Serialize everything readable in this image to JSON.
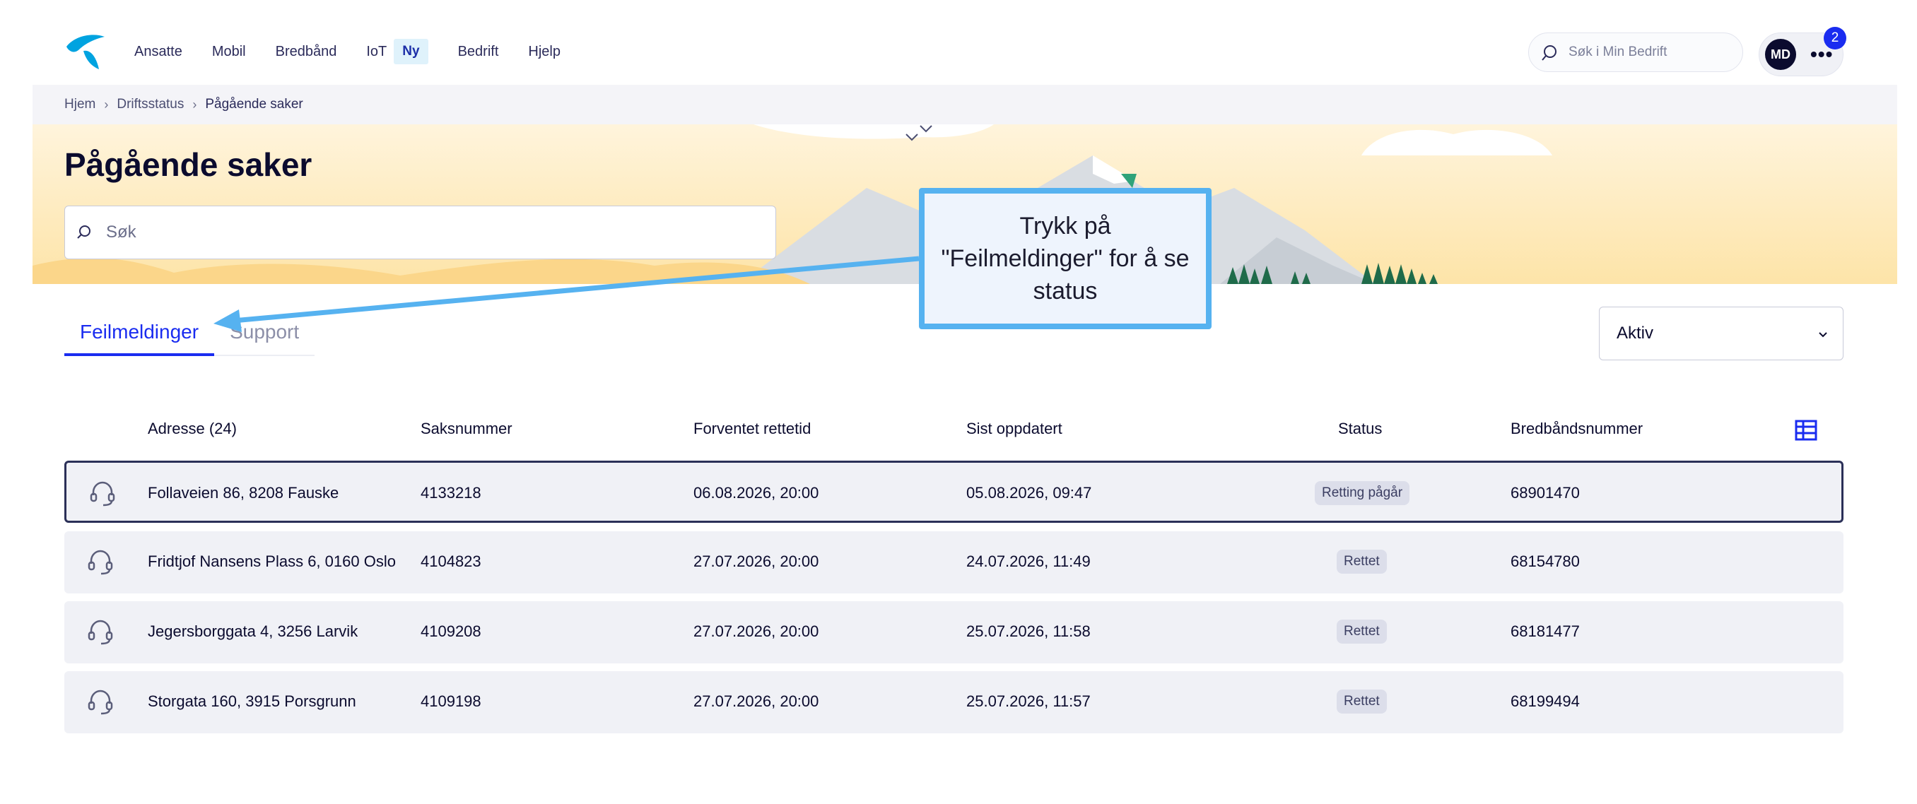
{
  "nav": {
    "items": [
      "Ansatte",
      "Mobil",
      "Bredbånd",
      "IoT",
      "Bedrift",
      "Hjelp"
    ],
    "iot_badge": "Ny",
    "search_placeholder": "Søk i Min Bedrift",
    "user_initials": "MD",
    "notification_count": "2"
  },
  "breadcrumb": [
    "Hjem",
    "Driftsstatus",
    "Pågående saker"
  ],
  "page": {
    "title": "Pågående saker",
    "search_placeholder": "Søk"
  },
  "tabs": [
    "Feilmeldinger",
    "Support"
  ],
  "active_tab": "Feilmeldinger",
  "filter": {
    "selected": "Aktiv"
  },
  "table": {
    "headers": [
      "Adresse (24)",
      "Saksnummer",
      "Forventet rettetid",
      "Sist oppdatert",
      "Status",
      "Bredbåndsnummer"
    ],
    "rows": [
      {
        "address": "Follaveien 86, 8208 Fauske",
        "case": "4133218",
        "expected": "06.08.2026, 20:00",
        "updated": "05.08.2026, 09:47",
        "status": "Retting pågår",
        "broadband": "68901470"
      },
      {
        "address": "Fridtjof Nansens Plass 6, 0160 Oslo",
        "case": "4104823",
        "expected": "27.07.2026, 20:00",
        "updated": "24.07.2026, 11:49",
        "status": "Rettet",
        "broadband": "68154780"
      },
      {
        "address": "Jegersborggata 4, 3256 Larvik",
        "case": "4109208",
        "expected": "27.07.2026, 20:00",
        "updated": "25.07.2026, 11:58",
        "status": "Rettet",
        "broadband": "68181477"
      },
      {
        "address": "Storgata 160, 3915 Porsgrunn",
        "case": "4109198",
        "expected": "27.07.2026, 20:00",
        "updated": "25.07.2026, 11:57",
        "status": "Rettet",
        "broadband": "68199494"
      }
    ]
  },
  "callout": {
    "text": "Trykk på \"Feilmeldinger\" for å se status"
  },
  "colors": {
    "accent": "#1a2cf0",
    "brand": "#00a3e0",
    "callout_border": "#56b2f0"
  }
}
